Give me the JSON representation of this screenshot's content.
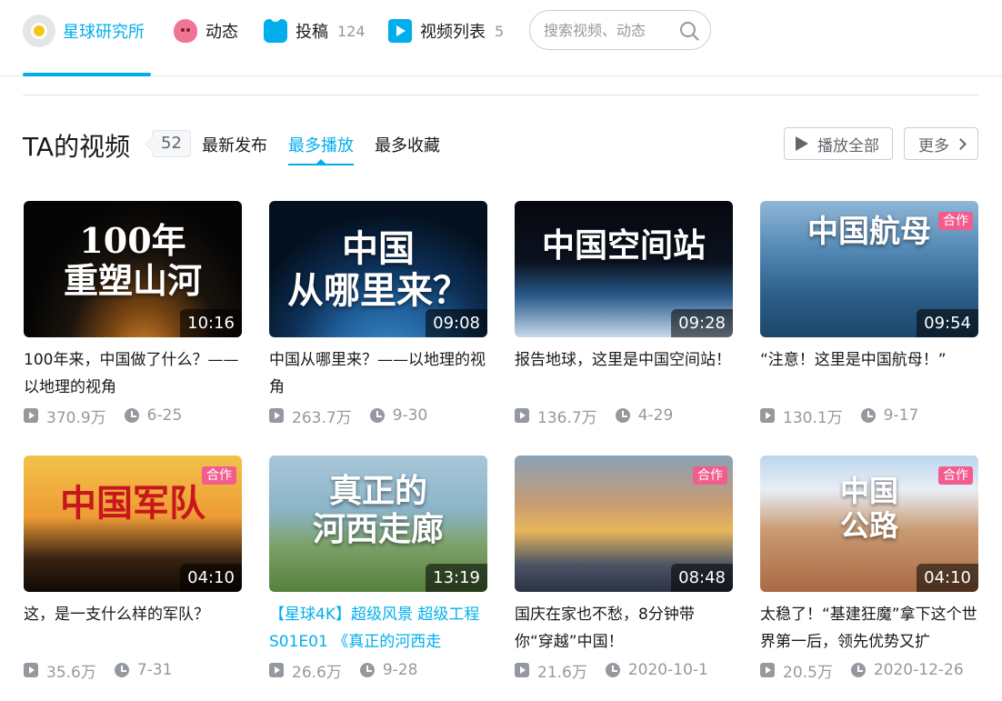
{
  "nav": {
    "home": "星球研究所",
    "dynamic": "动态",
    "upload": "投稿",
    "upload_count": "124",
    "video_list": "视频列表",
    "video_list_count": "5",
    "search_placeholder": "搜索视频、动态"
  },
  "section": {
    "title": "TA的视频",
    "count": "52",
    "tabs": [
      "最新发布",
      "最多播放",
      "最多收藏"
    ],
    "active_tab": "最多播放",
    "play_all": "播放全部",
    "more": "更多"
  },
  "videos": [
    {
      "thumb_text": "100年\n重塑山河",
      "duration": "10:16",
      "tag": "",
      "title": "100年来，中国做了什么？——以地理的视角",
      "views": "370.9万",
      "date": "6-25"
    },
    {
      "thumb_text": "中国\n从哪里来？",
      "duration": "09:08",
      "tag": "",
      "title": "中国从哪里来？——以地理的视角",
      "views": "263.7万",
      "date": "9-30"
    },
    {
      "thumb_text": "中国空间站",
      "duration": "09:28",
      "tag": "",
      "title": "报告地球，这里是中国空间站！",
      "views": "136.7万",
      "date": "4-29"
    },
    {
      "thumb_text": "中国航母",
      "duration": "09:54",
      "tag": "合作",
      "title": "“注意！这里是中国航母！”",
      "views": "130.1万",
      "date": "9-17"
    },
    {
      "thumb_text": "中国军队",
      "duration": "04:10",
      "tag": "合作",
      "title": "这，是一支什么样的军队？",
      "views": "35.6万",
      "date": "7-31"
    },
    {
      "thumb_text": "真正的\n河西走廊",
      "duration": "13:19",
      "tag": "",
      "title": "【星球4K】超级风景 超级工程 S01E01 《真正的河西走",
      "views": "26.6万",
      "date": "9-28"
    },
    {
      "thumb_text": "",
      "duration": "08:48",
      "tag": "合作",
      "title": "国庆在家也不愁，8分钟带你“穿越”中国！",
      "views": "21.6万",
      "date": "2020-10-1"
    },
    {
      "thumb_text": "中国\n公路",
      "duration": "04:10",
      "tag": "合作",
      "title": "太稳了！“基建狂魔”拿下这个世界第一后，领先优势又扩",
      "views": "20.5万",
      "date": "2020-12-26"
    }
  ],
  "colors": {
    "accent": "#00aeec",
    "tag": "#f25d8e",
    "muted": "#9499a0"
  }
}
